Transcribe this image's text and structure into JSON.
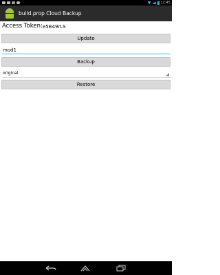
{
  "status_bar": {
    "time": "12:45",
    "left_icons": [
      "image-icon",
      "image-icon",
      "android-icon",
      "cloud-icon"
    ],
    "accent_color": "#33b5e5"
  },
  "action_bar": {
    "title": "build.prop Cloud Backup",
    "icon": "android-icon",
    "background": "#2b2b2b"
  },
  "form": {
    "token_label": "Access Token:",
    "token_value": "e5B49rLS",
    "update_label": "Update",
    "backup_name_value": "mod1",
    "backup_label": "Backup",
    "restore_select_value": "original",
    "restore_label": "Restore"
  },
  "nav_bar": {
    "buttons": [
      "back-icon",
      "home-icon",
      "recent-apps-icon"
    ]
  }
}
